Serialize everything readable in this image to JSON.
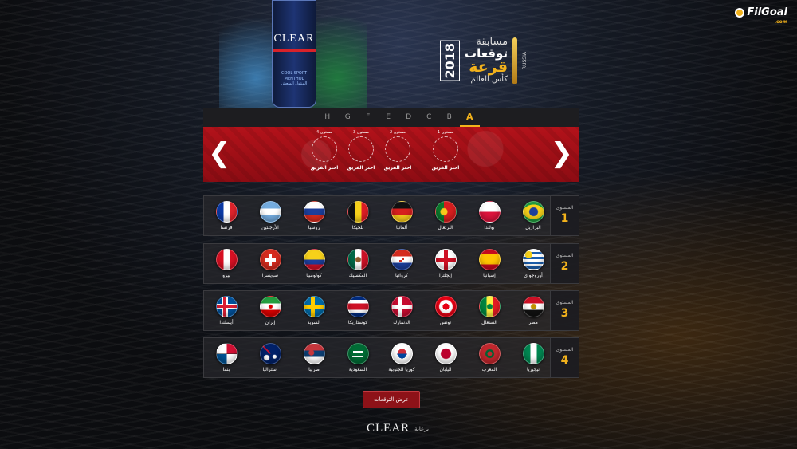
{
  "site": {
    "logo": "FilGoal",
    "logo_sub": ".com"
  },
  "product": {
    "brand": "CLEAR",
    "variant": "COOL SPORT MENTHOL",
    "variant_ar": "المنثول المنعش"
  },
  "contest": {
    "line1": "مسابقة",
    "line2": "توقعات",
    "line3": "قرعة",
    "line4": "كأس العالم",
    "year": "2018",
    "country": "RUSSIA"
  },
  "tabs": [
    "H",
    "G",
    "F",
    "E",
    "D",
    "C",
    "B",
    "A"
  ],
  "active_tab": "A",
  "slots": [
    {
      "level": "مستوى 4",
      "pick": "اختر الفريق"
    },
    {
      "level": "مستوى 3",
      "pick": "اختر الفريق"
    },
    {
      "level": "مستوى 2",
      "pick": "اختر الفريق"
    },
    {
      "level": "مستوى 1",
      "pick": "اختر الفريق"
    }
  ],
  "levels": [
    {
      "label": "المستوى",
      "number": "1",
      "teams": [
        {
          "name": "فرنسا",
          "flag": "france"
        },
        {
          "name": "الأرجنتين",
          "flag": "argentina"
        },
        {
          "name": "روسيا",
          "flag": "russia"
        },
        {
          "name": "بلجيكا",
          "flag": "belgium"
        },
        {
          "name": "ألمانيا",
          "flag": "germany"
        },
        {
          "name": "البرتغال",
          "flag": "portugal"
        },
        {
          "name": "بولندا",
          "flag": "poland"
        },
        {
          "name": "البرازيل",
          "flag": "brazil"
        }
      ]
    },
    {
      "label": "المستوى",
      "number": "2",
      "teams": [
        {
          "name": "بيرو",
          "flag": "peru"
        },
        {
          "name": "سويسرا",
          "flag": "switzerland"
        },
        {
          "name": "كولومبيا",
          "flag": "colombia"
        },
        {
          "name": "المكسيك",
          "flag": "mexico"
        },
        {
          "name": "كرواتيا",
          "flag": "croatia"
        },
        {
          "name": "إنجلترا",
          "flag": "england"
        },
        {
          "name": "إسبانيا",
          "flag": "spain"
        },
        {
          "name": "أوروجواي",
          "flag": "uruguay"
        }
      ]
    },
    {
      "label": "المستوى",
      "number": "3",
      "teams": [
        {
          "name": "أيسلندا",
          "flag": "iceland"
        },
        {
          "name": "إيران",
          "flag": "iran"
        },
        {
          "name": "السويد",
          "flag": "sweden"
        },
        {
          "name": "كوستاريكا",
          "flag": "costa-rica"
        },
        {
          "name": "الدنمارك",
          "flag": "denmark"
        },
        {
          "name": "تونس",
          "flag": "tunisia"
        },
        {
          "name": "السنغال",
          "flag": "senegal"
        },
        {
          "name": "مصر",
          "flag": "egypt"
        }
      ]
    },
    {
      "label": "المستوى",
      "number": "4",
      "teams": [
        {
          "name": "بنما",
          "flag": "panama"
        },
        {
          "name": "أستراليا",
          "flag": "australia"
        },
        {
          "name": "صربيا",
          "flag": "serbia"
        },
        {
          "name": "السعودية",
          "flag": "saudi-arabia"
        },
        {
          "name": "كوريا الجنوبية",
          "flag": "south-korea"
        },
        {
          "name": "اليابان",
          "flag": "japan"
        },
        {
          "name": "المغرب",
          "flag": "morocco"
        },
        {
          "name": "نيجيريا",
          "flag": "nigeria"
        }
      ]
    }
  ],
  "predict_button": "عرض التوقعات",
  "sponsor": {
    "by": "برعاية",
    "brand": "CLEAR"
  },
  "colors": {
    "accent": "#f2b21c",
    "banner_red": "#b3121a",
    "button_red": "#8d1218"
  }
}
